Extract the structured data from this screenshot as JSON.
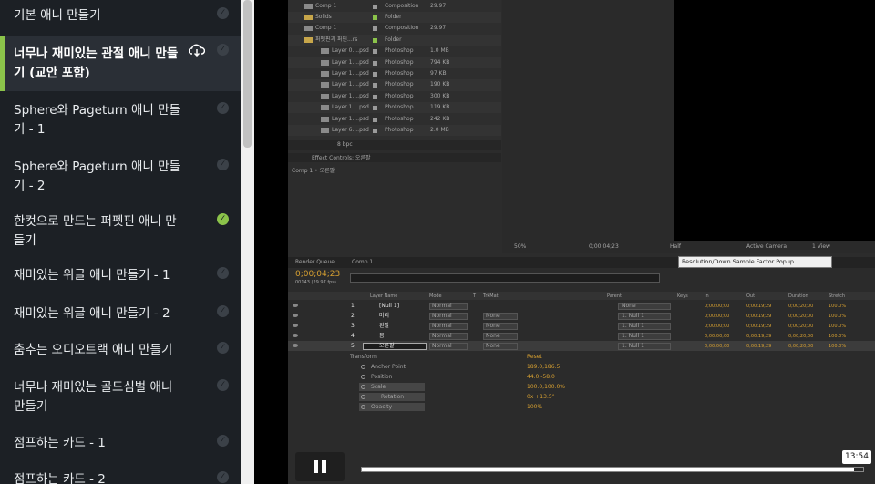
{
  "sidebar": {
    "items": [
      {
        "line1": "기본 애니 만들기",
        "line2": "",
        "status": "incomplete",
        "active": false
      },
      {
        "line1": "너무나 재미있는 관절 애니 만들",
        "line2": "기 (교안 포함)",
        "status": "incomplete",
        "active": true
      },
      {
        "line1": "Sphere와 Pageturn 애니 만들",
        "line2": "기 - 1",
        "status": "incomplete",
        "active": false
      },
      {
        "line1": "Sphere와 Pageturn 애니 만들",
        "line2": "기 - 2",
        "status": "incomplete",
        "active": false
      },
      {
        "line1": "한컷으로 만드는 퍼펫핀 애니 만",
        "line2": "들기",
        "status": "complete",
        "active": false
      },
      {
        "line1": "재미있는 위글 애니 만들기 - 1",
        "line2": "",
        "status": "incomplete",
        "active": false
      },
      {
        "line1": "재미있는 위글 애니 만들기 - 2",
        "line2": "",
        "status": "incomplete",
        "active": false
      },
      {
        "line1": "춤추는 오디오트랙 애니 만들기",
        "line2": "",
        "status": "incomplete",
        "active": false
      },
      {
        "line1": "너무나 재미있는 골드심벌 애니",
        "line2": "만들기",
        "status": "incomplete",
        "active": false
      },
      {
        "line1": "점프하는 카드 - 1",
        "line2": "",
        "status": "incomplete",
        "active": false
      },
      {
        "line1": "점프하는 카드 - 2",
        "line2": "",
        "status": "incomplete",
        "active": false
      }
    ],
    "check_glyph": "✓",
    "active_icon": "download-cloud-icon"
  },
  "project": {
    "rows": [
      {
        "name": "Comp 1",
        "type": "Composition",
        "size": "29.97",
        "label": "gray",
        "indent": 0
      },
      {
        "name": "Solids",
        "type": "Folder",
        "size": "",
        "label": "green",
        "indent": 0
      },
      {
        "name": "Comp 1",
        "type": "Composition",
        "size": "29.97",
        "label": "gray",
        "indent": 0
      },
      {
        "name": "퍼펫핀과 퍼핀...rs",
        "type": "Folder",
        "size": "",
        "label": "green",
        "indent": 0
      },
      {
        "name": "Layer 0....psd",
        "type": "Photoshop",
        "size": "1.0 MB",
        "label": "gray",
        "indent": 1
      },
      {
        "name": "Layer 1....psd",
        "type": "Photoshop",
        "size": "794 KB",
        "label": "gray",
        "indent": 1
      },
      {
        "name": "Layer 1....psd",
        "type": "Photoshop",
        "size": "97 KB",
        "label": "gray",
        "indent": 1
      },
      {
        "name": "Layer 1....psd",
        "type": "Photoshop",
        "size": "190 KB",
        "label": "gray",
        "indent": 1
      },
      {
        "name": "Layer 1....psd",
        "type": "Photoshop",
        "size": "300 KB",
        "label": "gray",
        "indent": 1
      },
      {
        "name": "Layer 1....psd",
        "type": "Photoshop",
        "size": "119 KB",
        "label": "gray",
        "indent": 1
      },
      {
        "name": "Layer 1....psd",
        "type": "Photoshop",
        "size": "242 KB",
        "label": "gray",
        "indent": 1
      },
      {
        "name": "Layer 6....psd",
        "type": "Photoshop",
        "size": "2.0 MB",
        "label": "gray",
        "indent": 1
      }
    ],
    "footer": "8 bpc"
  },
  "effect_controls": {
    "tab": "Effect Controls: 오른팔",
    "crumb": "Comp 1 • 오른팔"
  },
  "viewer": {
    "zoom": "50%",
    "timecode": "0;00;04;23",
    "resolution": "Half",
    "camera": "Active Camera",
    "view": "1 View",
    "tooltip": "Resolution/Down Sample Factor Popup"
  },
  "timeline": {
    "tabs": [
      "Render Queue",
      "Comp 1"
    ],
    "timecode": "0;00;04;23",
    "frames": "00143 (29.97 fps)",
    "headers": {
      "layer": "Layer Name",
      "mode": "Mode",
      "t": "T",
      "trkmat": "TrkMat",
      "parent": "Parent",
      "keys": "Keys",
      "in": "In",
      "out": "Out",
      "duration": "Duration",
      "stretch": "Stretch"
    },
    "layers": [
      {
        "num": "1",
        "name": "[Null 1]",
        "mode": "Normal",
        "trkmat": "",
        "parent": "None",
        "in": "0;00;00;00",
        "out": "0;00;19;29",
        "dur": "0;00;20;00",
        "stretch": "100.0%"
      },
      {
        "num": "2",
        "name": "머리",
        "mode": "Normal",
        "trkmat": "None",
        "parent": "1. Null 1",
        "in": "0;00;00;00",
        "out": "0;00;19;29",
        "dur": "0;00;20;00",
        "stretch": "100.0%"
      },
      {
        "num": "3",
        "name": "왼팔",
        "mode": "Normal",
        "trkmat": "None",
        "parent": "1. Null 1",
        "in": "0;00;00;00",
        "out": "0;00;19;29",
        "dur": "0;00;20;00",
        "stretch": "100.0%"
      },
      {
        "num": "4",
        "name": "몸",
        "mode": "Normal",
        "trkmat": "None",
        "parent": "1. Null 1",
        "in": "0;00;00;00",
        "out": "0;00;19;29",
        "dur": "0;00;20;00",
        "stretch": "100.0%"
      },
      {
        "num": "5",
        "name": "오른팔",
        "mode": "Normal",
        "trkmat": "None",
        "parent": "1. Null 1",
        "in": "0;00;00;00",
        "out": "0;00;19;29",
        "dur": "0;00;20;00",
        "stretch": "100.0%"
      }
    ],
    "transform": {
      "label": "Transform",
      "reset": "Reset",
      "props": [
        {
          "name": "Anchor Point",
          "value": "189.0,186.5"
        },
        {
          "name": "Position",
          "value": "44.0,-58.0"
        },
        {
          "name": "Scale",
          "value": "100.0,100.0%"
        },
        {
          "name": "Rotation",
          "value": "0x +13.5°"
        },
        {
          "name": "Opacity",
          "value": "100%"
        }
      ]
    }
  },
  "player": {
    "time": "13:54",
    "progress": 0.982
  }
}
